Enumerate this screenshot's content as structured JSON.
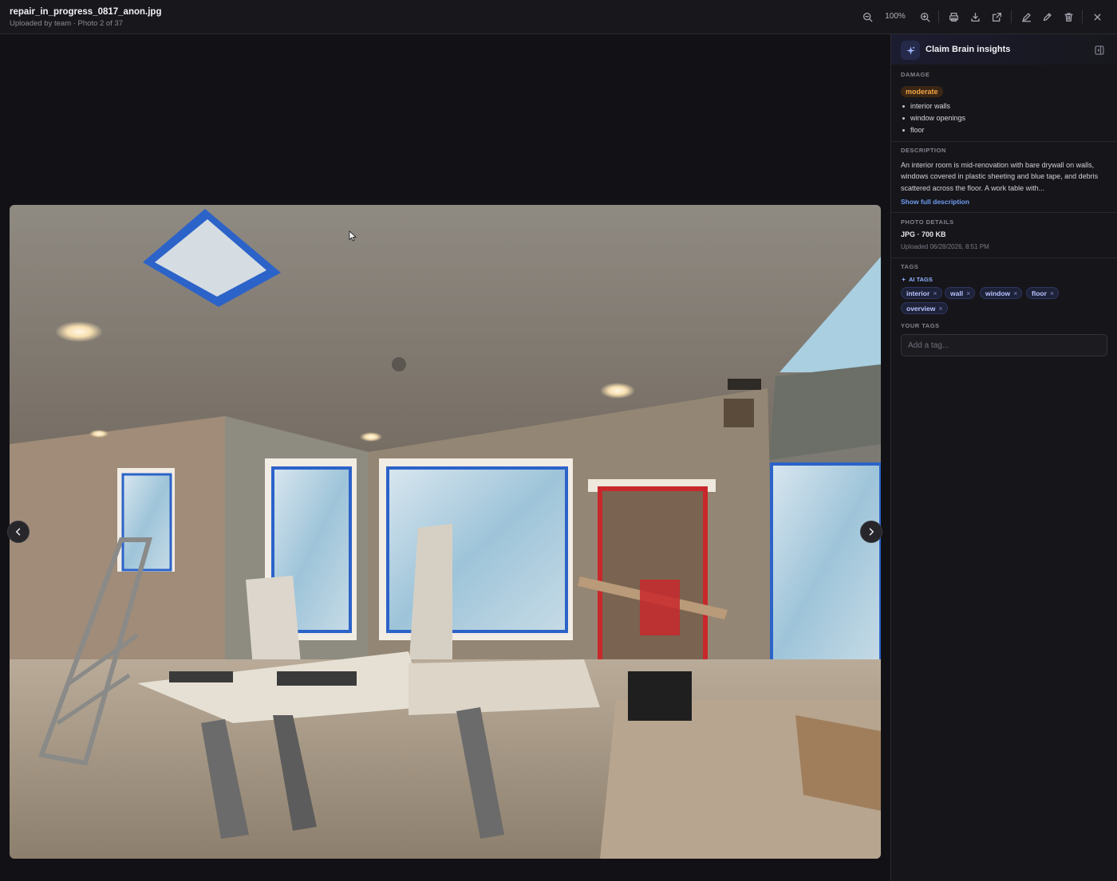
{
  "header": {
    "file_name": "repair_in_progress_0817_anon.jpg",
    "subtitle": "Uploaded by team · Photo 2 of 37",
    "zoom_level": "100%",
    "icons": [
      "zoom-out-icon",
      "zoom-in-icon",
      "print-icon",
      "download-icon",
      "open-external-icon",
      "annotate-icon",
      "edit-icon",
      "delete-icon",
      "close-icon"
    ]
  },
  "viewer": {
    "photo_subject": "interior-room-under-renovation",
    "nav_icons": [
      "chevron-left-icon",
      "chevron-right-icon"
    ]
  },
  "panel": {
    "title": "Claim Brain insights",
    "damage": {
      "label": "DAMAGE",
      "severity": "moderate",
      "areas": [
        "interior walls",
        "window openings",
        "floor"
      ]
    },
    "description": {
      "label": "DESCRIPTION",
      "text": "An interior room is mid-renovation with bare drywall on walls, windows covered in plastic sheeting and blue tape, and debris scattered across the floor. A work table with...",
      "show_more": "Show full description"
    },
    "photo_details": {
      "label": "PHOTO DETAILS",
      "type_size": "JPG · 700 KB",
      "uploaded": "Uploaded 06/28/2026, 8:51 PM"
    },
    "tags": {
      "label": "TAGS",
      "ai_label": "AI TAGS",
      "ai_tags": [
        "interior",
        "wall",
        "window",
        "floor",
        "overview"
      ],
      "remove_symbol": "×",
      "your_label": "YOUR TAGS",
      "input_placeholder": "Add a tag..."
    }
  },
  "colors": {
    "background": "#121216",
    "panel": "#16161a",
    "accent": "#6d9cf2",
    "severity_moderate": "#f2a447",
    "tag_bg": "#1e2238"
  }
}
